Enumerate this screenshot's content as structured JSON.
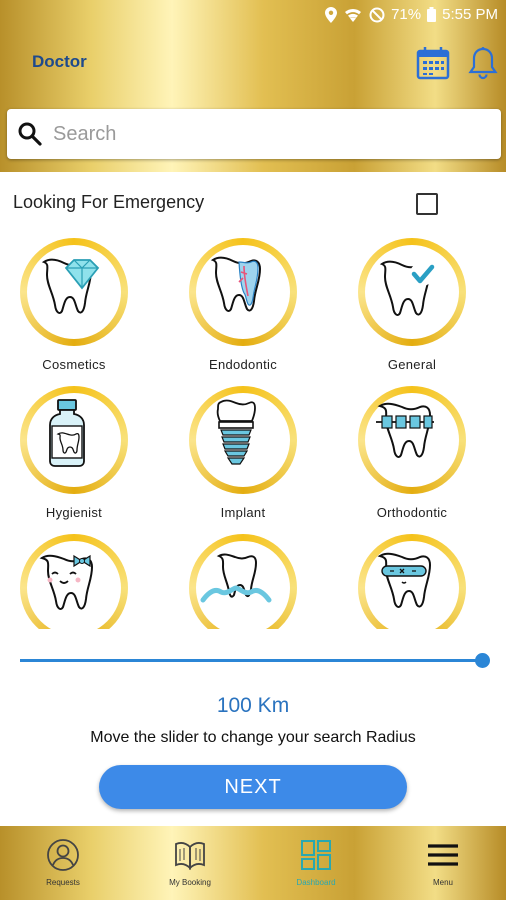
{
  "status_bar": {
    "battery": "71%",
    "time": "5:55 PM"
  },
  "app_bar": {
    "title": "Doctor",
    "calendar_icon": "calendar-icon",
    "bell_icon": "bell-icon"
  },
  "search": {
    "placeholder": "Search",
    "value": ""
  },
  "emergency": {
    "label": "Looking For Emergency",
    "checked": false
  },
  "categories": [
    {
      "label": "Cosmetics",
      "icon": "tooth-diamond-icon"
    },
    {
      "label": "Endodontic",
      "icon": "tooth-root-icon"
    },
    {
      "label": "General",
      "icon": "tooth-check-icon"
    },
    {
      "label": "Hygienist",
      "icon": "mouthwash-icon"
    },
    {
      "label": "Implant",
      "icon": "implant-icon"
    },
    {
      "label": "Orthodontic",
      "icon": "braces-icon"
    },
    {
      "label": "",
      "icon": "happy-tooth-bow-icon"
    },
    {
      "label": "",
      "icon": "tooth-gum-icon"
    },
    {
      "label": "",
      "icon": "sleeping-tooth-icon"
    }
  ],
  "slider": {
    "value_fraction": 1.0
  },
  "radius": {
    "value": "100 Km",
    "hint": "Move the slider to change your search Radius"
  },
  "next_button": {
    "label": "NEXT"
  },
  "bottom_nav": [
    {
      "label": "Requests",
      "icon": "user-icon"
    },
    {
      "label": "My Booking",
      "icon": "book-icon"
    },
    {
      "label": "Dashboard",
      "icon": "dashboard-icon"
    },
    {
      "label": "Menu",
      "icon": "menu-icon"
    }
  ],
  "colors": {
    "gold_accent": "#e9cf6a",
    "primary_blue": "#3d8ae8",
    "title_blue": "#1e4a8c",
    "dashboard_teal": "#2aa8b0"
  }
}
